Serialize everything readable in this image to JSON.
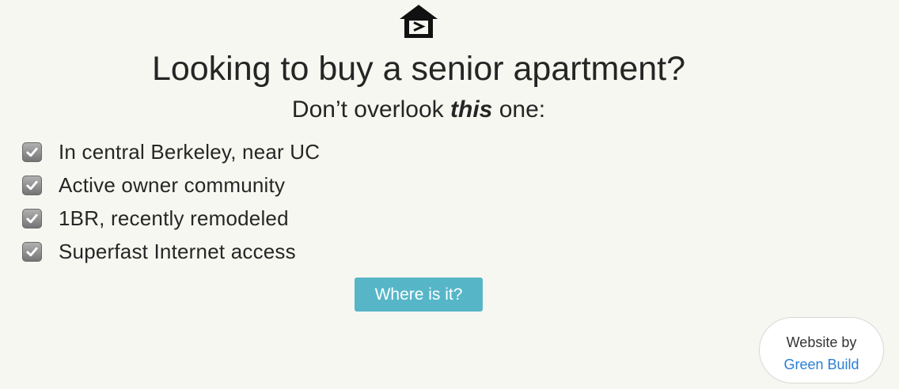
{
  "logo": {
    "icon": "equal-housing-icon"
  },
  "headline": "Looking to buy a senior apartment?",
  "subhead": {
    "before": "Don’t overlook ",
    "emphasis": "this",
    "after": " one:"
  },
  "features": [
    "In central Berkeley, near UC",
    "Active owner community",
    "1BR, recently remodeled",
    "Superfast Internet access"
  ],
  "features_checked": [
    true,
    true,
    true,
    true
  ],
  "cta": {
    "label": "Where is it?",
    "color": "#56b6c8"
  },
  "credit": {
    "text": "Website by",
    "link_label": "Green Build",
    "link_color": "#2a7fd4"
  },
  "colors": {
    "background": "#f7f7f1",
    "text": "#252525"
  }
}
